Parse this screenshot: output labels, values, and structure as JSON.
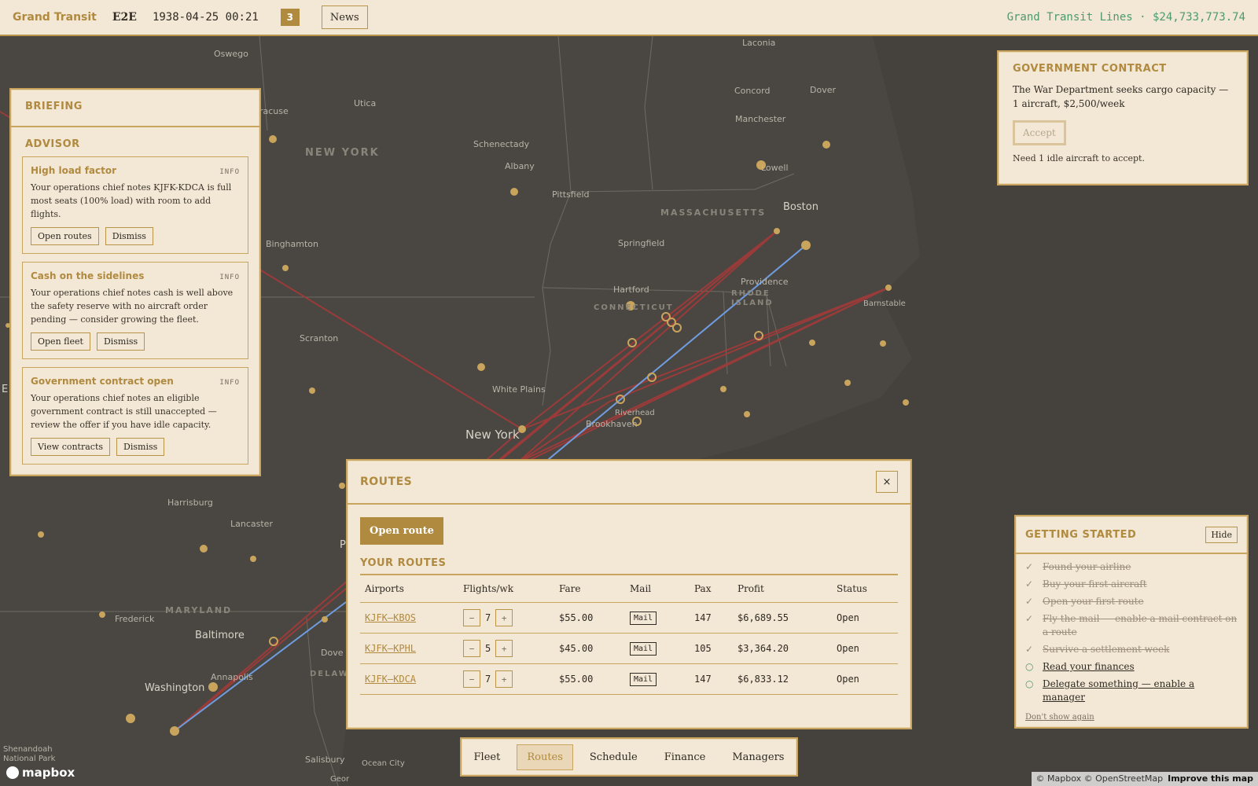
{
  "topbar": {
    "brand": "Grand Transit",
    "code": "E2E",
    "datetime": "1938-04-25 00:21",
    "news_count": "3",
    "news_label": "News",
    "company_summary": "Grand Transit Lines · $24,733,773.74"
  },
  "map": {
    "labels": {
      "oswego": "Oswego",
      "laconia": "Laconia",
      "utica": "Utica",
      "syracuse": "racuse",
      "new_york_state": "NEW YORK",
      "schenectady": "Schenectady",
      "albany": "Albany",
      "concord": "Concord",
      "dover": "Dover",
      "manchester": "Manchester",
      "lowell": "Lowell",
      "boston": "Boston",
      "pittsfield": "Pittsfield",
      "massachusetts": "MASSACHUSETTS",
      "binghamton": "Binghamton",
      "springfield": "Springfield",
      "hartford": "Hartford",
      "providence": "Providence",
      "rhode": "RHODE",
      "island": "ISLAND",
      "connecticut": "CONNECTICUT",
      "barnstable": "Barnstable",
      "scranton": "Scranton",
      "white_plains": "White Plains",
      "riverhead": "Riverhead",
      "brookhaven": "Brookhaven",
      "new_york_city": "New York",
      "harrisburg": "Harrisburg",
      "lancaster": "Lancaster",
      "maryland": "MARYLAND",
      "frederick": "Frederick",
      "baltimore": "Baltimore",
      "annapolis": "Annapolis",
      "washington": "Washington",
      "dover_de": "Dove",
      "delaware": "DELAWA",
      "shenandoah": "Shenandoah",
      "national_park": "National Park",
      "salisbury": "Salisbury",
      "ocean_city": "Ocean City",
      "georg": "Geor",
      "p_edge": "P",
      "e_edge": "E"
    },
    "logo": "mapbox",
    "attribution": "© Mapbox © OpenStreetMap",
    "improve": "Improve this map"
  },
  "briefing": {
    "title": "BRIEFING",
    "advisor_title": "ADVISOR",
    "cards": [
      {
        "title": "High load factor",
        "tag": "INFO",
        "body": "Your operations chief notes KJFK-KDCA is full most seats (100% load) with room to add flights.",
        "action": "Open routes",
        "dismiss": "Dismiss"
      },
      {
        "title": "Cash on the sidelines",
        "tag": "INFO",
        "body": "Your operations chief notes cash is well above the safety reserve with no aircraft order pending — consider growing the fleet.",
        "action": "Open fleet",
        "dismiss": "Dismiss"
      },
      {
        "title": "Government contract open",
        "tag": "INFO",
        "body": "Your operations chief notes an eligible government contract is still unaccepted — review the offer if you have idle capacity.",
        "action": "View contracts",
        "dismiss": "Dismiss"
      }
    ]
  },
  "gov_contract": {
    "title": "GOVERNMENT CONTRACT",
    "body": "The War Department seeks cargo capacity — 1 aircraft, $2,500/week",
    "accept": "Accept",
    "note": "Need 1 idle aircraft to accept."
  },
  "routes": {
    "title": "ROUTES",
    "close": "×",
    "open_route": "Open route",
    "subtitle": "YOUR ROUTES",
    "columns": [
      "Airports",
      "Flights/wk",
      "Fare",
      "Mail",
      "Pax",
      "Profit",
      "Status"
    ],
    "rows": [
      {
        "airports": "KJFK–KBOS",
        "flights": "7",
        "fare": "$55.00",
        "mail": "Mail",
        "pax": "147",
        "profit": "$6,689.55",
        "status": "Open"
      },
      {
        "airports": "KJFK–KPHL",
        "flights": "5",
        "fare": "$45.00",
        "mail": "Mail",
        "pax": "105",
        "profit": "$3,364.20",
        "status": "Open"
      },
      {
        "airports": "KJFK–KDCA",
        "flights": "7",
        "fare": "$55.00",
        "mail": "Mail",
        "pax": "147",
        "profit": "$6,833.12",
        "status": "Open"
      }
    ],
    "minus": "−",
    "plus": "+"
  },
  "getting_started": {
    "title": "GETTING STARTED",
    "hide": "Hide",
    "items": [
      {
        "text": "Found your airline",
        "done": true
      },
      {
        "text": "Buy your first aircraft",
        "done": true
      },
      {
        "text": "Open your first route",
        "done": true
      },
      {
        "text": "Fly the mail — enable a mail contract on a route",
        "done": true
      },
      {
        "text": "Survive a settlement week",
        "done": true
      },
      {
        "text": "Read your finances",
        "done": false
      },
      {
        "text": "Delegate something — enable a manager",
        "done": false
      }
    ],
    "done_mark": "✓",
    "todo_mark": "○",
    "dont_show": "Don't show again"
  },
  "nav": {
    "tabs": [
      "Fleet",
      "Routes",
      "Schedule",
      "Finance",
      "Managers"
    ],
    "active": "Routes"
  },
  "colors": {
    "accent": "#b08a3e",
    "panel": "#f3e7d6",
    "map_bg": "#4a4742",
    "route_red": "#a33a3a",
    "route_blue": "#6f9de0",
    "money_green": "#4c9a6e"
  }
}
